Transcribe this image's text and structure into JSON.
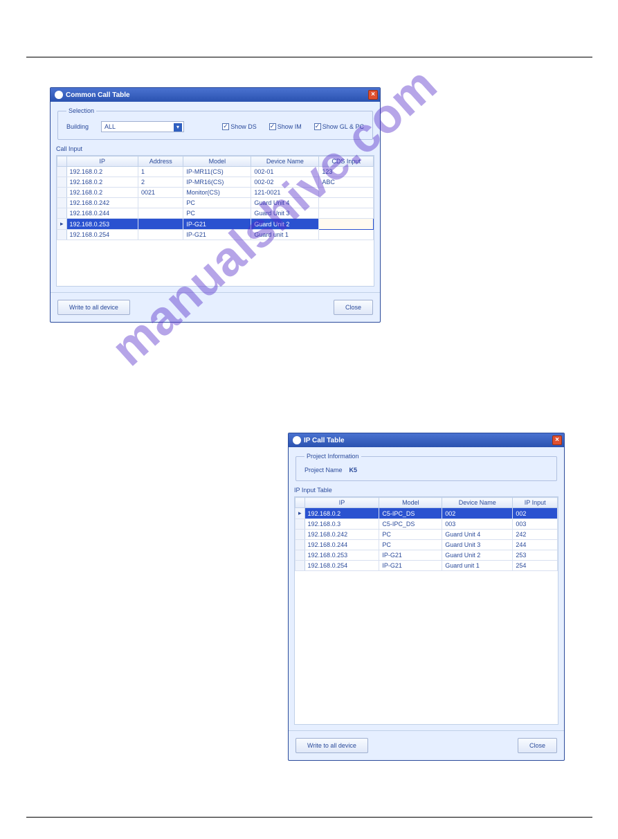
{
  "watermark": "manualshive.com",
  "dialog1": {
    "title": "Common Call Table",
    "close": "×",
    "selection": {
      "legend": "Selection",
      "building_label": "Building",
      "building_value": "ALL",
      "show_ds": "Show DS",
      "show_im": "Show IM",
      "show_gl_pc": "Show GL & PC"
    },
    "grid_label": "Call Input",
    "headers": [
      "IP",
      "Address",
      "Model",
      "Device Name",
      "CDS Input"
    ],
    "rows": [
      {
        "ip": "192.168.0.2",
        "address": "1",
        "model": "IP-MR11(CS)",
        "device": "002-01",
        "cds": "123",
        "selected": false
      },
      {
        "ip": "192.168.0.2",
        "address": "2",
        "model": "IP-MR16(CS)",
        "device": "002-02",
        "cds": "ABC",
        "selected": false
      },
      {
        "ip": "192.168.0.2",
        "address": "0021",
        "model": "Monitor(CS)",
        "device": "121-0021",
        "cds": "",
        "selected": false
      },
      {
        "ip": "192.168.0.242",
        "address": "",
        "model": "PC",
        "device": "Guard Unit 4",
        "cds": "",
        "selected": false
      },
      {
        "ip": "192.168.0.244",
        "address": "",
        "model": "PC",
        "device": "Guard Unit 3",
        "cds": "",
        "selected": false
      },
      {
        "ip": "192.168.0.253",
        "address": "",
        "model": "IP-G21",
        "device": "Guard Unit 2",
        "cds": "",
        "selected": true
      },
      {
        "ip": "192.168.0.254",
        "address": "",
        "model": "IP-G21",
        "device": "Guard unit 1",
        "cds": "",
        "selected": false
      }
    ],
    "btn_write": "Write to all device",
    "btn_close": "Close"
  },
  "dialog2": {
    "title": "IP Call Table",
    "close": "×",
    "project": {
      "legend": "Project Information",
      "name_label": "Project Name",
      "name_value": "K5"
    },
    "grid_label": "IP Input Table",
    "headers": [
      "IP",
      "Model",
      "Device Name",
      "IP Input"
    ],
    "rows": [
      {
        "ip": "192.168.0.2",
        "model": "C5-IPC_DS",
        "device": "002",
        "ipin": "002",
        "selected": true
      },
      {
        "ip": "192.168.0.3",
        "model": "C5-IPC_DS",
        "device": "003",
        "ipin": "003",
        "selected": false
      },
      {
        "ip": "192.168.0.242",
        "model": "PC",
        "device": "Guard Unit 4",
        "ipin": "242",
        "selected": false
      },
      {
        "ip": "192.168.0.244",
        "model": "PC",
        "device": "Guard Unit 3",
        "ipin": "244",
        "selected": false
      },
      {
        "ip": "192.168.0.253",
        "model": "IP-G21",
        "device": "Guard Unit 2",
        "ipin": "253",
        "selected": false
      },
      {
        "ip": "192.168.0.254",
        "model": "IP-G21",
        "device": "Guard unit 1",
        "ipin": "254",
        "selected": false
      }
    ],
    "btn_write": "Write to all device",
    "btn_close": "Close"
  }
}
